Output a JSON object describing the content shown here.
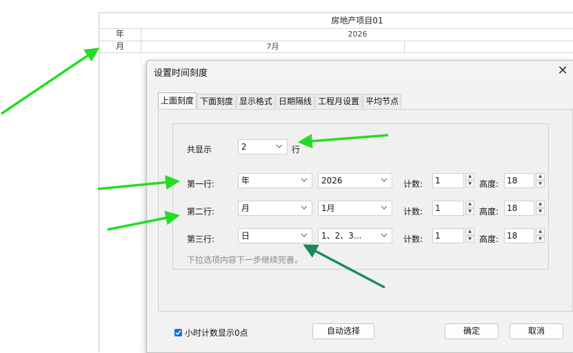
{
  "gantt": {
    "project_title": "房地产项目01",
    "row_labels": [
      "年",
      "月"
    ],
    "year_value": "2026",
    "month_value": "7月"
  },
  "dialog": {
    "title": "设置时间刻度",
    "close_glyph": "✕",
    "tabs": [
      "上面刻度",
      "下面刻度",
      "显示格式",
      "日期隔线",
      "工程月设置",
      "平均节点"
    ],
    "active_tab": "上面刻度",
    "total_rows_label": "共显示",
    "total_rows_value": "2",
    "total_rows_suffix": "行",
    "rows": [
      {
        "label": "第一行:",
        "unit": "年",
        "format": "2026",
        "count_label": "计数:",
        "count": "1",
        "height_label": "高度:",
        "height": "18"
      },
      {
        "label": "第二行:",
        "unit": "月",
        "format": "1月",
        "count_label": "计数:",
        "count": "1",
        "height_label": "高度:",
        "height": "18"
      },
      {
        "label": "第三行:",
        "unit": "日",
        "format": "1、2、3...",
        "count_label": "计数:",
        "count": "1",
        "height_label": "高度:",
        "height": "18"
      }
    ],
    "hint": "下拉选项内容下一步继续完善。",
    "checkbox_label": "小时计数显示0点",
    "checkbox_checked": true,
    "auto_select_label": "自动选择",
    "ok_label": "确定",
    "cancel_label": "取消"
  },
  "colors": {
    "arrow_light": "#22dd22",
    "arrow_dark": "#1a8a5a",
    "checkbox_accent": "#1a73c6"
  }
}
